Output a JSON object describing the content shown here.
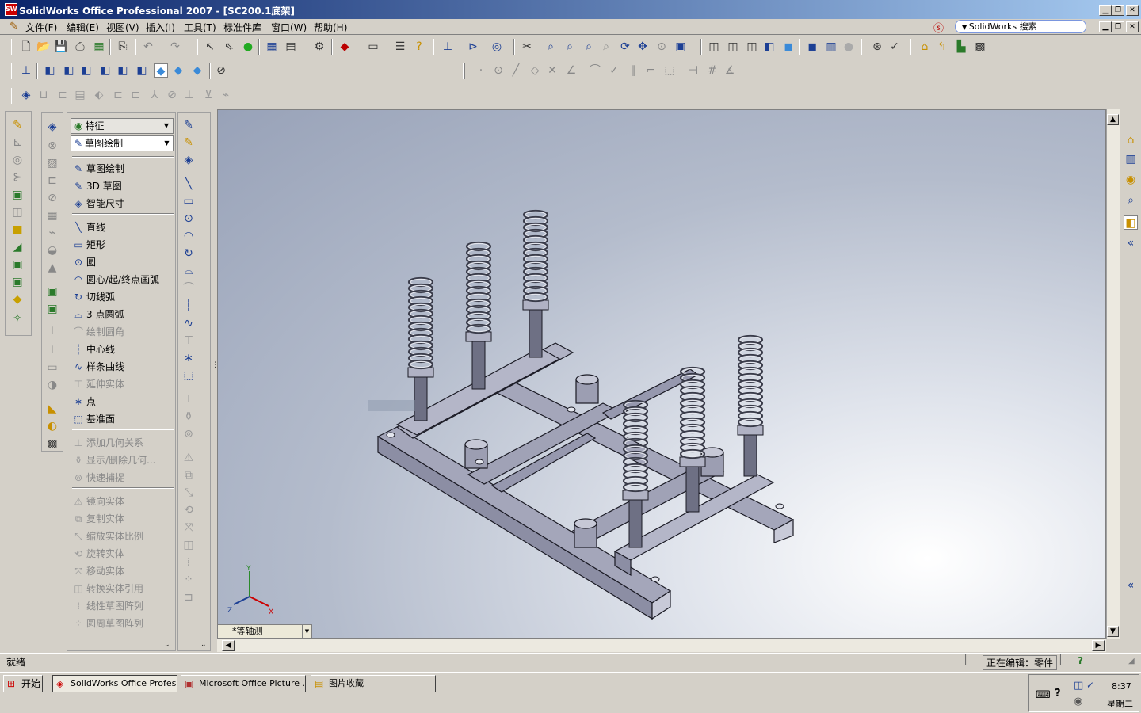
{
  "window": {
    "title": "SolidWorks Office Professional 2007 - [SC200.1底架]",
    "app_icon_text": "SW"
  },
  "menu": {
    "items": [
      "文件(F)",
      "编辑(E)",
      "视图(V)",
      "插入(I)",
      "工具(T)",
      "标准件库",
      "窗口(W)",
      "帮助(H)"
    ],
    "search_label": "SolidWorks 搜索"
  },
  "command_panel": {
    "combo_features": "特征",
    "combo_sketch": "草图绘制",
    "items": [
      {
        "label": "草图绘制",
        "icon": "sketch-icon",
        "enabled": true
      },
      {
        "label": "3D 草图",
        "icon": "3d-sketch-icon",
        "enabled": true
      },
      {
        "label": "智能尺寸",
        "icon": "smart-dimension-icon",
        "enabled": true
      },
      {
        "label": "直线",
        "icon": "line-icon",
        "enabled": true
      },
      {
        "label": "矩形",
        "icon": "rectangle-icon",
        "enabled": true
      },
      {
        "label": "圆",
        "icon": "circle-icon",
        "enabled": true
      },
      {
        "label": "圆心/起/终点画弧",
        "icon": "centerpoint-arc-icon",
        "enabled": true
      },
      {
        "label": "切线弧",
        "icon": "tangent-arc-icon",
        "enabled": true
      },
      {
        "label": "3 点圆弧",
        "icon": "3point-arc-icon",
        "enabled": true
      },
      {
        "label": "绘制圆角",
        "icon": "sketch-fillet-icon",
        "enabled": false
      },
      {
        "label": "中心线",
        "icon": "centerline-icon",
        "enabled": true
      },
      {
        "label": "样条曲线",
        "icon": "spline-icon",
        "enabled": true
      },
      {
        "label": "延伸实体",
        "icon": "extend-entities-icon",
        "enabled": false
      },
      {
        "label": "点",
        "icon": "point-icon",
        "enabled": true
      },
      {
        "label": "基准面",
        "icon": "plane-icon",
        "enabled": true
      },
      {
        "label": "添加几何关系",
        "icon": "add-relation-icon",
        "enabled": false
      },
      {
        "label": "显示/删除几何...",
        "icon": "display-relations-icon",
        "enabled": false
      },
      {
        "label": "快速捕捉",
        "icon": "quick-snap-icon",
        "enabled": false
      },
      {
        "label": "镜向实体",
        "icon": "mirror-entities-icon",
        "enabled": false
      },
      {
        "label": "复制实体",
        "icon": "copy-entities-icon",
        "enabled": false
      },
      {
        "label": "缩放实体比例",
        "icon": "scale-entities-icon",
        "enabled": false
      },
      {
        "label": "旋转实体",
        "icon": "rotate-entities-icon",
        "enabled": false
      },
      {
        "label": "移动实体",
        "icon": "move-entities-icon",
        "enabled": false
      },
      {
        "label": "转换实体引用",
        "icon": "convert-entities-icon",
        "enabled": false
      },
      {
        "label": "线性草图阵列",
        "icon": "linear-pattern-icon",
        "enabled": false
      },
      {
        "label": "圆周草图阵列",
        "icon": "circular-pattern-icon",
        "enabled": false
      }
    ]
  },
  "viewport": {
    "view_orientation": "*等轴测",
    "triad_labels": {
      "x": "X",
      "y": "Y",
      "z": "Z"
    }
  },
  "statusbar": {
    "left": "就绪",
    "editing": "正在编辑：零件"
  },
  "taskbar": {
    "start_label": "开始",
    "tasks": [
      {
        "label": "SolidWorks Office Profes...",
        "active": true
      },
      {
        "label": "Microsoft Office Picture ...",
        "active": false
      },
      {
        "label": "图片收藏",
        "active": false
      }
    ],
    "clock_time": "8:37",
    "clock_day": "星期二"
  },
  "colors": {
    "titlebar_start": "#0a246a",
    "titlebar_end": "#a6caf0",
    "model_fill": "#9ea0b4",
    "model_edge": "#1a1a24"
  }
}
